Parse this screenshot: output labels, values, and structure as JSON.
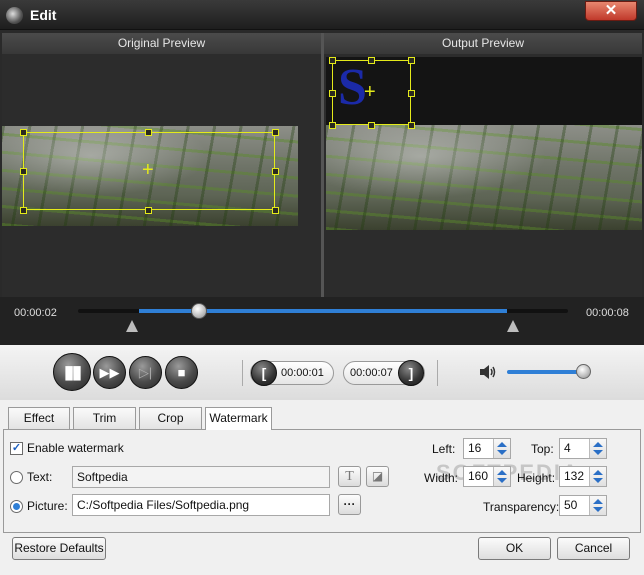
{
  "window": {
    "title": "Edit",
    "close_glyph": "✕"
  },
  "preview": {
    "original_label": "Original Preview",
    "output_label": "Output Preview"
  },
  "timeline": {
    "start_time": "00:00:02",
    "end_time": "00:00:08",
    "progress_fraction": 0.25
  },
  "playback": {
    "pause_icon": "pause-icon",
    "next_icon": "next-frame-icon",
    "stop_icon": "stop-icon",
    "trim_start": "00:00:01",
    "trim_end": "00:00:07",
    "volume_fraction": 1.0
  },
  "tabs": [
    {
      "label": "Effect"
    },
    {
      "label": "Trim"
    },
    {
      "label": "Crop"
    },
    {
      "label": "Watermark",
      "active": true
    }
  ],
  "watermark": {
    "enable_label": "Enable watermark",
    "enabled": true,
    "text_label": "Text:",
    "text_value": "Softpedia",
    "text_selected": false,
    "picture_label": "Picture:",
    "picture_path": "C:/Softpedia Files/Softpedia.png",
    "picture_selected": true,
    "browse_label": "···",
    "font_icon_label": "T",
    "left_label": "Left:",
    "left_value": "16",
    "top_label": "Top:",
    "top_value": "4",
    "width_label": "Width:",
    "width_value": "160",
    "height_label": "Height:",
    "height_value": "132",
    "transparency_label": "Transparency:",
    "transparency_value": "50",
    "overlay_text": "SOFTPEDIA"
  },
  "footer": {
    "restore_label": "Restore Defaults",
    "ok_label": "OK",
    "cancel_label": "Cancel"
  },
  "colors": {
    "accent": "#2f7fd6",
    "selection": "#e4ea1a",
    "close": "#c0392b"
  }
}
